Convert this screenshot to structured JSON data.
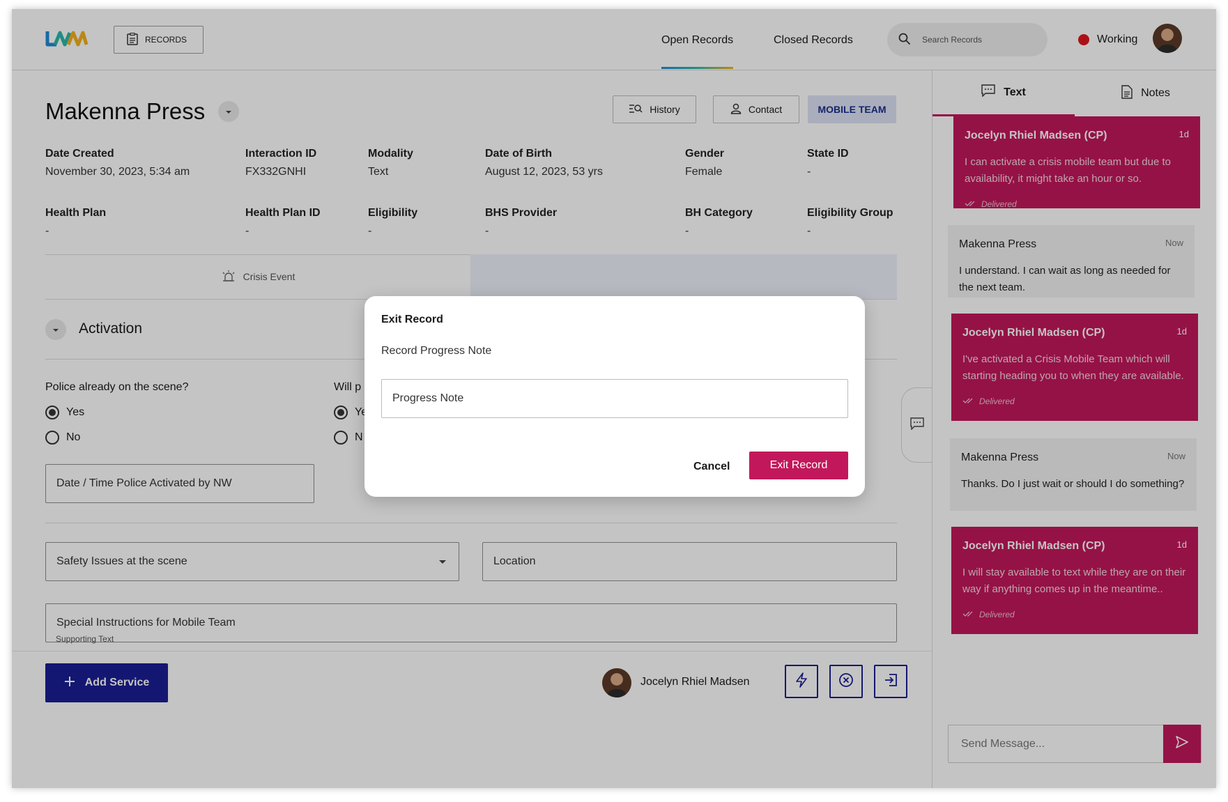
{
  "header": {
    "records_label": "RECORDS",
    "tabs": [
      {
        "label": "Open Records",
        "active": true
      },
      {
        "label": "Closed Records",
        "active": false
      }
    ],
    "search_placeholder": "Search Records",
    "status_label": "Working",
    "status_color": "#e0151f"
  },
  "record": {
    "client_name": "Makenna Press",
    "actions": {
      "history": "History",
      "contact": "Contact",
      "mobile_team": "MOBILE TEAM"
    },
    "fields_row1": [
      {
        "label": "Date Created",
        "value": "November 30, 2023, 5:34 am"
      },
      {
        "label": "Interaction ID",
        "value": "FX332GNHI"
      },
      {
        "label": "Modality",
        "value": "Text"
      },
      {
        "label": "Date of Birth",
        "value": "August 12, 2023, 53 yrs"
      },
      {
        "label": "Gender",
        "value": "Female"
      },
      {
        "label": "State ID",
        "value": "-"
      }
    ],
    "fields_row2": [
      {
        "label": "Health Plan",
        "value": "-"
      },
      {
        "label": "Health Plan ID",
        "value": "-"
      },
      {
        "label": "Eligibility",
        "value": "-"
      },
      {
        "label": "BHS Provider",
        "value": "-"
      },
      {
        "label": "BH Category",
        "value": "-"
      },
      {
        "label": "Eligibility Group",
        "value": "-"
      }
    ],
    "crisis_tab_label": "Crisis Event",
    "section_title": "Activation",
    "question1": "Police already on the scene?",
    "question2_partial": "Will p",
    "radio_yes": "Yes",
    "radio_no": "No",
    "radio_yes_partial": "Ye",
    "radio_no_partial": "N",
    "police_time_label": "Date / Time Police Activated by NW",
    "safety_label": "Safety Issues at the scene",
    "location_label": "Location",
    "special_label": "Special Instructions for Mobile Team",
    "supporting_text": "Supporting Text"
  },
  "footer": {
    "add_service": "Add Service",
    "agent_name": "Jocelyn Rhiel Madsen"
  },
  "panel": {
    "tabs": [
      {
        "label": "Text",
        "active": true
      },
      {
        "label": "Notes",
        "active": false
      }
    ],
    "messages": [
      {
        "dir": "out",
        "sender": "Jocelyn Rhiel Madsen (CP)",
        "time": "1d",
        "text": "I can activate a crisis mobile team but due to availability, it might take an hour or so.",
        "delivered": "Delivered"
      },
      {
        "dir": "in",
        "sender": "Makenna Press",
        "time": "Now",
        "text": "I understand. I can wait as long as needed for the next team."
      },
      {
        "dir": "out",
        "sender": "Jocelyn Rhiel Madsen (CP)",
        "time": "1d",
        "text": "I've activated a Crisis Mobile Team which will starting heading you to when they are available.",
        "delivered": "Delivered"
      },
      {
        "dir": "in",
        "sender": "Makenna Press",
        "time": "Now",
        "text": "Thanks. Do I just wait or should I do something?"
      },
      {
        "dir": "out",
        "sender": "Jocelyn Rhiel Madsen (CP)",
        "time": "1d",
        "text": "I will stay available to text while they are on their way if anything comes up in the meantime..",
        "delivered": "Delivered"
      }
    ],
    "send_placeholder": "Send Message..."
  },
  "modal": {
    "title": "Exit Record",
    "subtitle": "Record Progress Note",
    "input_label": "Progress Note",
    "cancel": "Cancel",
    "confirm": "Exit Record"
  },
  "colors": {
    "accent": "#c2185b",
    "primary": "#1a1f93",
    "mobile_team_bg": "#dde3f5"
  }
}
